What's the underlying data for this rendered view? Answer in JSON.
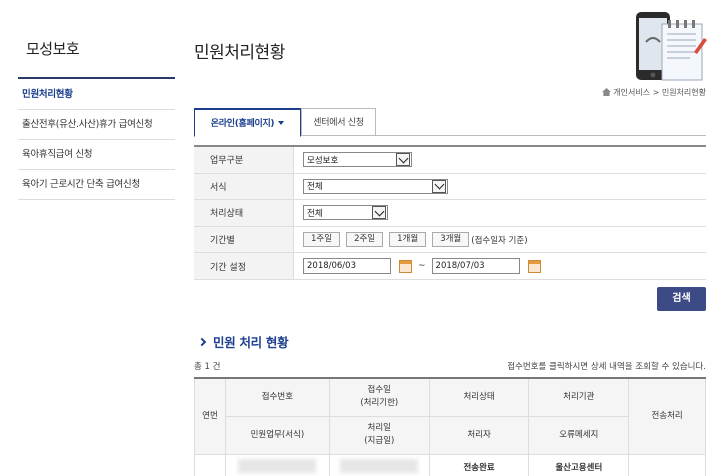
{
  "sidebar": {
    "title": "모성보호",
    "items": [
      {
        "label": "민원처리현황",
        "active": true
      },
      {
        "label": "출산전후(유산.사산)휴가 급여신청",
        "active": false
      },
      {
        "label": "육아휴직급여 신청",
        "active": false
      },
      {
        "label": "육아기 근로시간 단축 급여신청",
        "active": false
      }
    ]
  },
  "page": {
    "title": "민원처리현황",
    "breadcrumb": "개인서비스 > 민원처리현황"
  },
  "tabs": [
    {
      "label": "온라인(홈페이지)",
      "active": true
    },
    {
      "label": "센터에서 신청",
      "active": false
    }
  ],
  "form": {
    "work_type_label": "업무구분",
    "work_type_value": "모성보호",
    "format_label": "서식",
    "format_value": "전체",
    "status_label": "처리상태",
    "status_value": "전체",
    "period_label": "기간별",
    "period_buttons": [
      "1주일",
      "2주일",
      "1개월",
      "3개월"
    ],
    "period_note": "(접수일자 기준)",
    "range_label": "기간 설정",
    "date_from": "2018/06/03",
    "date_to": "2018/07/03",
    "tilde": "~"
  },
  "search_label": "검색",
  "results": {
    "section_title": "민원 처리 현황",
    "total": "총 1 건",
    "hint": "접수번호를 클릭하시면 상세 내역을 조회할 수 있습니다.",
    "headers": {
      "no": "연번",
      "receipt_no": "접수번호",
      "receipt_date": "접수일",
      "receipt_deadline": "(처리기한)",
      "status": "처리상태",
      "agency": "처리기관",
      "transfer": "전송처리",
      "task": "민원업무(서식)",
      "process_date": "처리일",
      "payment_date": "(지급일)",
      "handler": "처리자",
      "error_msg": "오류메세지"
    },
    "rows": [
      {
        "status": "전송완료",
        "agency": "울산고용센터"
      }
    ]
  },
  "colors": {
    "accent": "#1c3f8f",
    "button": "#3c4a86"
  }
}
